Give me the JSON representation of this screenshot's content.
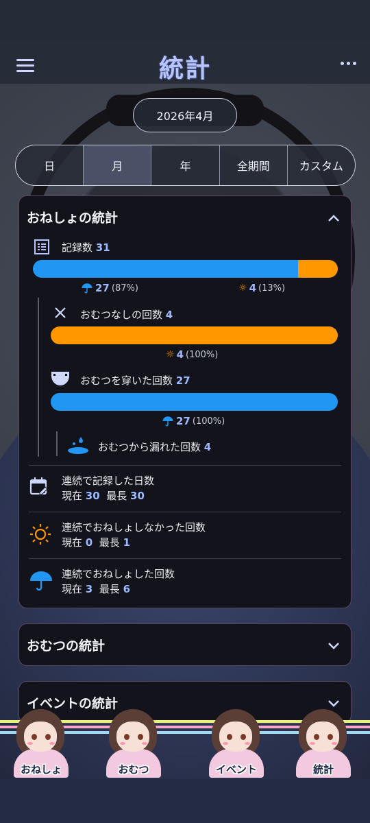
{
  "header": {
    "title": "統計"
  },
  "period": {
    "selected_month": "2026年4月",
    "tabs": [
      "日",
      "月",
      "年",
      "全期間",
      "カスタム"
    ],
    "active_tab": "月"
  },
  "bedwetting": {
    "title": "おねしょの統計",
    "records_label": "記録数",
    "records_count": "31",
    "wet_fraction": 0.87,
    "wet_count": "27",
    "wet_pct": "(87%)",
    "dry_count": "4",
    "dry_pct": "(13%)",
    "no_diaper_label": "おむつなしの回数",
    "no_diaper_count": "4",
    "no_diaper_dry_count": "4",
    "no_diaper_dry_pct": "(100%)",
    "diaper_label": "おむつを穿いた回数",
    "diaper_count": "27",
    "diaper_wet_count": "27",
    "diaper_wet_pct": "(100%)",
    "leak_label": "おむつから漏れた回数",
    "leak_count": "4",
    "streaks": [
      {
        "label": "連続で記録した日数",
        "current_label": "現在",
        "current": "30",
        "best_label": "最長",
        "best": "30"
      },
      {
        "label": "連続でおねしょしなかった回数",
        "current_label": "現在",
        "current": "0",
        "best_label": "最長",
        "best": "1"
      },
      {
        "label": "連続でおねしょした回数",
        "current_label": "現在",
        "current": "3",
        "best_label": "最長",
        "best": "6"
      }
    ]
  },
  "diaper_stats": {
    "title": "おむつの統計"
  },
  "event_stats": {
    "title": "イベントの統計"
  },
  "bottom_nav": [
    {
      "label": "おねしょ"
    },
    {
      "label": "おむつ"
    },
    {
      "label": "イベント"
    },
    {
      "label": "統計"
    }
  ],
  "colors": {
    "wet": "#2196f3",
    "dry": "#ff9800",
    "accent": "#9db8ff"
  }
}
